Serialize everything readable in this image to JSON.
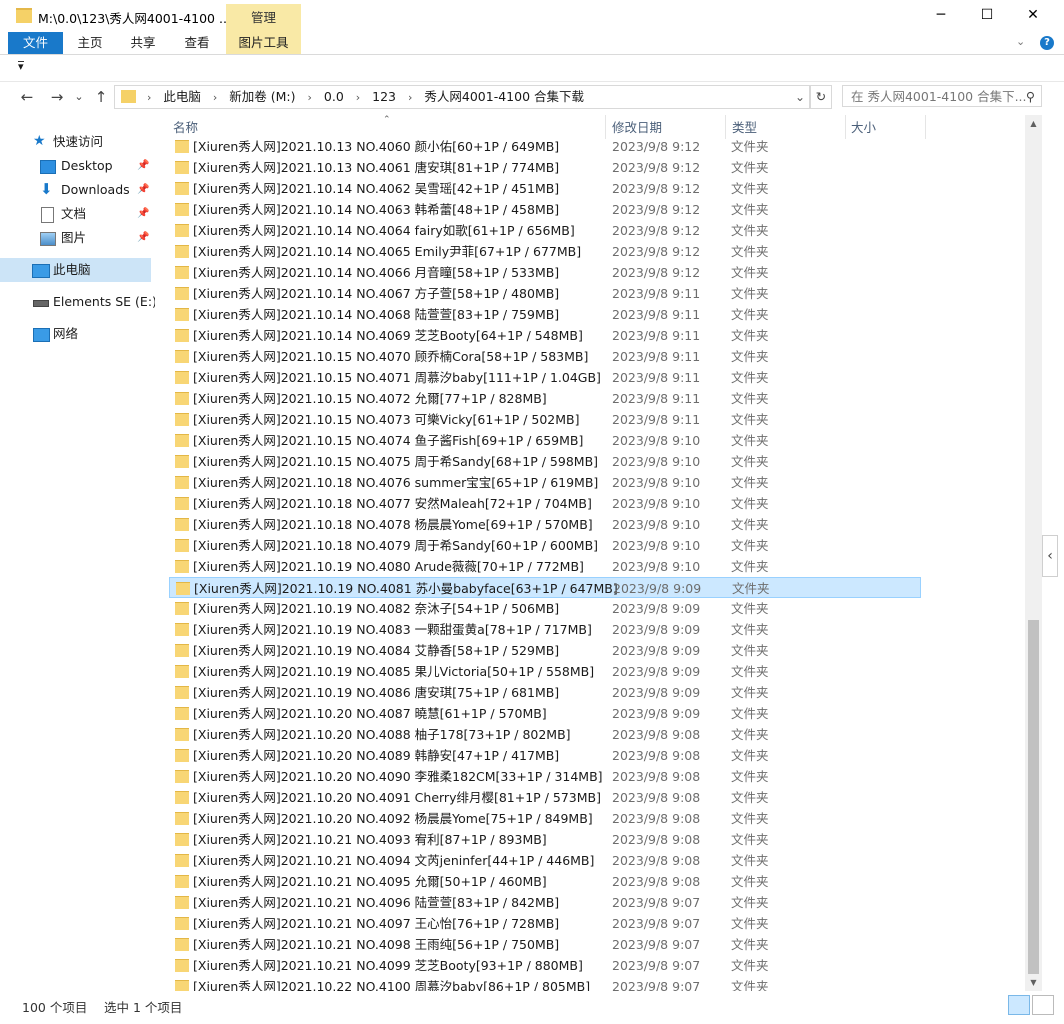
{
  "window": {
    "title": "M:\\0.0\\123\\秀人网4001-4100 ...",
    "context_tab": "管理",
    "minimize": "─",
    "maximize": "☐",
    "close": "✕"
  },
  "ribbon": {
    "tabs": [
      "文件",
      "主页",
      "共享",
      "查看",
      "图片工具"
    ],
    "collapse_icon": "chevron-down-icon",
    "help_label": "?"
  },
  "qat": {
    "dropdown_glyph": "▾"
  },
  "address": {
    "back": "←",
    "forward": "→",
    "recent": "⌄",
    "up": "↑",
    "crumbs": [
      "此电脑",
      "新加卷 (M:)",
      "0.0",
      "123",
      "秀人网4001-4100 合集下载"
    ],
    "refresh": "↻",
    "search_placeholder": "在 秀人网4001-4100 合集下...",
    "search_icon": "⚲"
  },
  "nav": {
    "items": [
      {
        "label": "快速访问",
        "icon": "star-icon"
      },
      {
        "label": "Desktop",
        "icon": "desktop-icon",
        "pinned": true
      },
      {
        "label": "Downloads",
        "icon": "download-icon",
        "pinned": true
      },
      {
        "label": "文档",
        "icon": "document-icon",
        "pinned": true
      },
      {
        "label": "图片",
        "icon": "picture-icon",
        "pinned": true
      },
      {
        "label": "此电脑",
        "icon": "computer-icon"
      },
      {
        "label": "Elements SE (E:)",
        "icon": "drive-icon"
      },
      {
        "label": "网络",
        "icon": "network-icon"
      }
    ]
  },
  "columns": {
    "name": "名称",
    "date": "修改日期",
    "type": "类型",
    "size": "大小"
  },
  "files": [
    {
      "name": "[Xiuren秀人网]2021.10.13 NO.4060 颜小佑[60+1P / 649MB]",
      "date": "2023/9/8 9:12",
      "type": "文件夹"
    },
    {
      "name": "[Xiuren秀人网]2021.10.13 NO.4061 唐安琪[81+1P / 774MB]",
      "date": "2023/9/8 9:12",
      "type": "文件夹"
    },
    {
      "name": "[Xiuren秀人网]2021.10.14 NO.4062 吴雪瑶[42+1P / 451MB]",
      "date": "2023/9/8 9:12",
      "type": "文件夹"
    },
    {
      "name": "[Xiuren秀人网]2021.10.14 NO.4063 韩希蕾[48+1P / 458MB]",
      "date": "2023/9/8 9:12",
      "type": "文件夹"
    },
    {
      "name": "[Xiuren秀人网]2021.10.14 NO.4064 fairy如歌[61+1P / 656MB]",
      "date": "2023/9/8 9:12",
      "type": "文件夹"
    },
    {
      "name": "[Xiuren秀人网]2021.10.14 NO.4065 Emily尹菲[67+1P / 677MB]",
      "date": "2023/9/8 9:12",
      "type": "文件夹"
    },
    {
      "name": "[Xiuren秀人网]2021.10.14 NO.4066 月音瞳[58+1P / 533MB]",
      "date": "2023/9/8 9:12",
      "type": "文件夹"
    },
    {
      "name": "[Xiuren秀人网]2021.10.14 NO.4067 方子萱[58+1P / 480MB]",
      "date": "2023/9/8 9:11",
      "type": "文件夹"
    },
    {
      "name": "[Xiuren秀人网]2021.10.14 NO.4068 陆萱萱[83+1P / 759MB]",
      "date": "2023/9/8 9:11",
      "type": "文件夹"
    },
    {
      "name": "[Xiuren秀人网]2021.10.14 NO.4069 芝芝Booty[64+1P / 548MB]",
      "date": "2023/9/8 9:11",
      "type": "文件夹"
    },
    {
      "name": "[Xiuren秀人网]2021.10.15 NO.4070 顾乔楠Cora[58+1P / 583MB]",
      "date": "2023/9/8 9:11",
      "type": "文件夹"
    },
    {
      "name": "[Xiuren秀人网]2021.10.15 NO.4071 周慕汐baby[111+1P / 1.04GB]",
      "date": "2023/9/8 9:11",
      "type": "文件夹"
    },
    {
      "name": "[Xiuren秀人网]2021.10.15 NO.4072 允爾[77+1P / 828MB]",
      "date": "2023/9/8 9:11",
      "type": "文件夹"
    },
    {
      "name": "[Xiuren秀人网]2021.10.15 NO.4073 可樂Vicky[61+1P / 502MB]",
      "date": "2023/9/8 9:11",
      "type": "文件夹"
    },
    {
      "name": "[Xiuren秀人网]2021.10.15 NO.4074 鱼子酱Fish[69+1P / 659MB]",
      "date": "2023/9/8 9:10",
      "type": "文件夹"
    },
    {
      "name": "[Xiuren秀人网]2021.10.15 NO.4075 周于希Sandy[68+1P / 598MB]",
      "date": "2023/9/8 9:10",
      "type": "文件夹"
    },
    {
      "name": "[Xiuren秀人网]2021.10.18 NO.4076 summer宝宝[65+1P / 619MB]",
      "date": "2023/9/8 9:10",
      "type": "文件夹"
    },
    {
      "name": "[Xiuren秀人网]2021.10.18 NO.4077 安然Maleah[72+1P / 704MB]",
      "date": "2023/9/8 9:10",
      "type": "文件夹"
    },
    {
      "name": "[Xiuren秀人网]2021.10.18 NO.4078 杨晨晨Yome[69+1P / 570MB]",
      "date": "2023/9/8 9:10",
      "type": "文件夹"
    },
    {
      "name": "[Xiuren秀人网]2021.10.18 NO.4079 周于希Sandy[60+1P / 600MB]",
      "date": "2023/9/8 9:10",
      "type": "文件夹"
    },
    {
      "name": "[Xiuren秀人网]2021.10.19 NO.4080 Arude薇薇[70+1P / 772MB]",
      "date": "2023/9/8 9:10",
      "type": "文件夹"
    },
    {
      "name": "[Xiuren秀人网]2021.10.19 NO.4081 苏小曼babyface[63+1P / 647MB]",
      "date": "2023/9/8 9:09",
      "type": "文件夹",
      "selected": true
    },
    {
      "name": "[Xiuren秀人网]2021.10.19 NO.4082 奈沐子[54+1P / 506MB]",
      "date": "2023/9/8 9:09",
      "type": "文件夹"
    },
    {
      "name": "[Xiuren秀人网]2021.10.19 NO.4083 一颗甜蛋黄a[78+1P / 717MB]",
      "date": "2023/9/8 9:09",
      "type": "文件夹"
    },
    {
      "name": "[Xiuren秀人网]2021.10.19 NO.4084 艾静香[58+1P / 529MB]",
      "date": "2023/9/8 9:09",
      "type": "文件夹"
    },
    {
      "name": "[Xiuren秀人网]2021.10.19 NO.4085 果儿Victoria[50+1P / 558MB]",
      "date": "2023/9/8 9:09",
      "type": "文件夹"
    },
    {
      "name": "[Xiuren秀人网]2021.10.19 NO.4086 唐安琪[75+1P / 681MB]",
      "date": "2023/9/8 9:09",
      "type": "文件夹"
    },
    {
      "name": "[Xiuren秀人网]2021.10.20 NO.4087 曉慧[61+1P / 570MB]",
      "date": "2023/9/8 9:09",
      "type": "文件夹"
    },
    {
      "name": "[Xiuren秀人网]2021.10.20 NO.4088 柚子178[73+1P / 802MB]",
      "date": "2023/9/8 9:08",
      "type": "文件夹"
    },
    {
      "name": "[Xiuren秀人网]2021.10.20 NO.4089 韩静安[47+1P / 417MB]",
      "date": "2023/9/8 9:08",
      "type": "文件夹"
    },
    {
      "name": "[Xiuren秀人网]2021.10.20 NO.4090 李雅柔182CM[33+1P / 314MB]",
      "date": "2023/9/8 9:08",
      "type": "文件夹"
    },
    {
      "name": "[Xiuren秀人网]2021.10.20 NO.4091 Cherry绯月樱[81+1P / 573MB]",
      "date": "2023/9/8 9:08",
      "type": "文件夹"
    },
    {
      "name": "[Xiuren秀人网]2021.10.20 NO.4092 杨晨晨Yome[75+1P / 849MB]",
      "date": "2023/9/8 9:08",
      "type": "文件夹"
    },
    {
      "name": "[Xiuren秀人网]2021.10.21 NO.4093 宥利[87+1P / 893MB]",
      "date": "2023/9/8 9:08",
      "type": "文件夹"
    },
    {
      "name": "[Xiuren秀人网]2021.10.21 NO.4094 文芮jeninfer[44+1P / 446MB]",
      "date": "2023/9/8 9:08",
      "type": "文件夹"
    },
    {
      "name": "[Xiuren秀人网]2021.10.21 NO.4095 允爾[50+1P / 460MB]",
      "date": "2023/9/8 9:08",
      "type": "文件夹"
    },
    {
      "name": "[Xiuren秀人网]2021.10.21 NO.4096 陆萱萱[83+1P / 842MB]",
      "date": "2023/9/8 9:07",
      "type": "文件夹"
    },
    {
      "name": "[Xiuren秀人网]2021.10.21 NO.4097 王心怡[76+1P / 728MB]",
      "date": "2023/9/8 9:07",
      "type": "文件夹"
    },
    {
      "name": "[Xiuren秀人网]2021.10.21 NO.4098 王雨纯[56+1P / 750MB]",
      "date": "2023/9/8 9:07",
      "type": "文件夹"
    },
    {
      "name": "[Xiuren秀人网]2021.10.21 NO.4099 芝芝Booty[93+1P / 880MB]",
      "date": "2023/9/8 9:07",
      "type": "文件夹"
    },
    {
      "name": "[Xiuren秀人网]2021.10.22 NO.4100 周慕汐baby[86+1P / 805MB]",
      "date": "2023/9/8 9:07",
      "type": "文件夹"
    }
  ],
  "scrollbar": {
    "up": "▲",
    "down": "▼",
    "position": 0.59
  },
  "side_toggle": "‹",
  "status": {
    "count": "100 个项目",
    "selected": "选中 1 个项目"
  },
  "colors": {
    "accent": "#1979ca",
    "selection": "#cce8ff",
    "selection_border": "#99d1ff",
    "folder": "#f8d675"
  }
}
